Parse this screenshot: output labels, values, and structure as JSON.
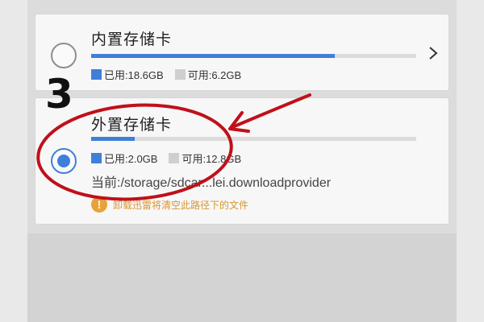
{
  "internal": {
    "title": "内置存储卡",
    "used_label": "已用:18.6GB",
    "free_label": "可用:6.2GB",
    "used_fraction": 0.75,
    "selected": false
  },
  "external": {
    "title": "外置存储卡",
    "used_label": "已用:2.0GB",
    "free_label": "可用:12.8GB",
    "used_fraction": 0.135,
    "selected": true,
    "path": "当前:/storage/sdcar...lei.downloadprovider",
    "warning": "卸载迅雷将清空此路径下的文件"
  },
  "annotation": {
    "step": "3"
  },
  "colors": {
    "accent": "#3f7fd8",
    "warning": "#e8a23a",
    "annotation": "#c0101a"
  },
  "icons": {
    "chevron": "chevron-right-icon",
    "warning": "warning-circle-icon"
  }
}
